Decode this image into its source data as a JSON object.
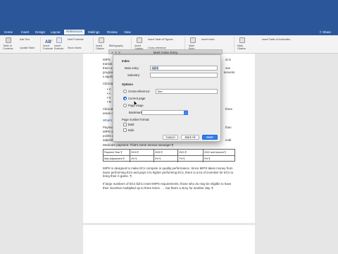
{
  "ribbon_tabs": [
    "Home",
    "Insert",
    "Design",
    "Layout",
    "References",
    "Mailings",
    "Review",
    "View"
  ],
  "active_tab": "References",
  "share_label": "Share",
  "ribbon_buttons": {
    "toc": "Table of\nContents",
    "add_text": "Add Text",
    "update_table": "Update Table",
    "insert_footnote": "Insert\nFootnote",
    "insert_endnote": "Insert\nEndnote",
    "next_footnote": "Next Footnote",
    "show_notes": "Show Notes",
    "insert_citation": "Insert\nCitation",
    "bibliography": "Bibliography",
    "insert_caption": "Insert\nCaption",
    "insert_table_of_figures": "Insert Table of Figures",
    "cross_reference": "Cross-reference",
    "mark_entry": "Mark\nEntry",
    "insert_index": "Insert Index",
    "mark_citation": "Mark\nCitation",
    "insert_table_of_authorities": "Insert Table of Authorities"
  },
  "document": {
    "line_a": "MIPS",
    "line_a_right": "al is",
    "line_b": "transiti",
    "line_c": "them a",
    "line_c_right": "ave",
    "line_d": "program",
    "line_d_right": "lements",
    "line_e": "s applic",
    "line_f": "Clinicia",
    "bullet_1": "• C",
    "bullet_2": "• A",
    "bullet_3": "• Ir",
    "bullet_4": "• R",
    "line_g": "Clinicia",
    "line_g_right": "three",
    "line_h": "areas d",
    "line_i": "What's",
    "line_j": "Paymen",
    "line_j_right": "than",
    "line_k": "MIPS sc",
    "line_l": "points w",
    "line_m": "adjustm",
    "line_m_right": "erall",
    "line_n": "Medicare payment. That's some serious sausage! ¶",
    "table": {
      "headers": [
        "Payment Year ¶",
        "2019 ¶",
        "2020 ¶",
        "2021 ¶",
        "2022 and beyond ¶"
      ],
      "row": [
        "Max Adjustment ¶",
        "4% ¶",
        "5% ¶",
        "7% ¶",
        "9% ¶"
      ]
    },
    "para_1": "MIPS is designed to make ECs compete in quality performance. Since MIPS takes money from lower performing ECs and pays it to higher performing ECs, there is a lot of incentive for ECs to bring their A-game. ¶",
    "para_2": "If large numbers of ECs fail to meet MIPS requirements, those who do may be eligible to have their incentive multiplied up to three times . . . but that's a story for another day. ¶"
  },
  "dialog": {
    "window_title": "Mark Index Entry",
    "section_index": "Index",
    "main_entry_label": "Main entry:",
    "main_entry_value": "MIPS",
    "subentry_label": "Subentry:",
    "subentry_value": "",
    "section_options": "Options",
    "cross_reference_label": "Cross-reference:",
    "cross_reference_value": "See",
    "current_page_label": "Current page",
    "page_range_label": "Page range",
    "bookmark_label": "Bookmark:",
    "page_number_format_label": "Page number format:",
    "bold_label": "Bold",
    "italic_label": "Italic",
    "cancel_button": "Cancel",
    "mark_all_button": "Mark All",
    "mark_button": "Mark"
  },
  "colors": {
    "ribbon_blue": "#2b579a",
    "accent": "#2f7ef5",
    "highlight": "#c7d6ef"
  }
}
